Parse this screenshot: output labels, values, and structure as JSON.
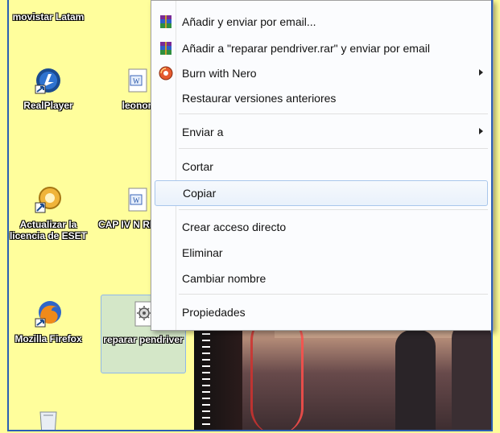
{
  "desktop": {
    "top_icon_label": "movistar Latam",
    "icons": [
      {
        "label": "RealPlayer",
        "icon": "realplayer-icon"
      },
      {
        "label": "leonor",
        "icon": "word-doc-icon"
      },
      {
        "label": "Actualizar la licencia de ESET",
        "icon": "eset-icon"
      },
      {
        "label": "CAP IV N REYES",
        "icon": "word-doc-icon"
      },
      {
        "label": "Mozilla Firefox",
        "icon": "firefox-icon"
      },
      {
        "label": "reparar pendriver",
        "icon": "settings-file-icon"
      },
      {
        "label": "",
        "icon": "recycle-bin-icon"
      }
    ]
  },
  "menu": {
    "items": [
      {
        "label": "Añadir y enviar por email...",
        "icon": "winrar-icon"
      },
      {
        "label": "Añadir a \"reparar pendriver.rar\" y enviar por email",
        "icon": "winrar-icon"
      },
      {
        "label": "Burn with Nero",
        "icon": "nero-icon",
        "submenu": true
      },
      {
        "label": "Restaurar versiones anteriores"
      },
      {
        "label": "Enviar a",
        "submenu": true
      },
      {
        "label": "Cortar"
      },
      {
        "label": "Copiar",
        "highlighted": true
      },
      {
        "label": "Crear acceso directo"
      },
      {
        "label": "Eliminar"
      },
      {
        "label": "Cambiar nombre"
      },
      {
        "label": "Propiedades"
      }
    ]
  },
  "colors": {
    "desktop_bg": "#fffe9c",
    "frame_border": "#2b5fb3",
    "menu_bg": "#fbfcfe",
    "highlight_border": "#a9c6eb"
  }
}
